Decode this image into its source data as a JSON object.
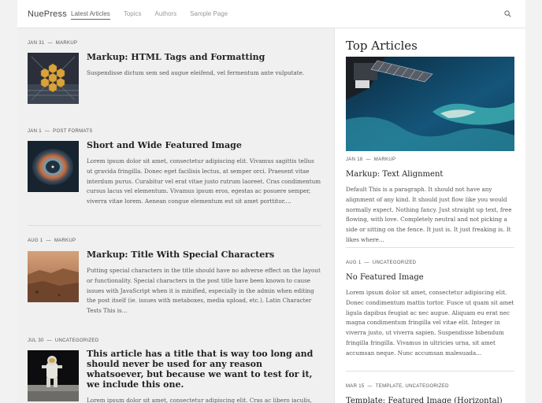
{
  "header": {
    "brand": "NuePress",
    "nav": [
      "Latest Articles",
      "Topics",
      "Authors",
      "Sample Page"
    ]
  },
  "icons": {
    "search": "search-icon"
  },
  "posts": [
    {
      "date": "JAN 31",
      "category": "MARKUP",
      "title": "Markup: HTML Tags and Formatting",
      "excerpt": "Suspendisse dictum sem sed augue eleifend, vel fermentum ante vulputate."
    },
    {
      "date": "JAN 1",
      "category": "POST FORMATS",
      "title": "Short and Wide Featured Image",
      "excerpt": "Lorem ipsum dolor sit amet, consectetur adipiscing elit. Vivamus sagittis tellus ut gravida fringilla. Donec eget facilisis lectus, at semper orci. Praesent vitae interdum purus. Curabitur vel erat vitae justo rutrum laoreet. Cras condimentum cursus lacus vel elementum. Vivamus ipsum eros, egestas ac posuere semper, viverra vitae lorem. Aenean congue elementum est sit amet porttitor...."
    },
    {
      "date": "AUG 1",
      "category": "MARKUP",
      "title": "Markup: Title With Special Characters",
      "excerpt": "Putting special characters in the title should have no adverse effect on the layout or functionality. Special characters in the post title have been known to cause issues with JavaScript when it is minified, especially in the admin when editing the post itself (ie. issues with metaboxes, media upload, etc.). Latin Character Tests This is..."
    },
    {
      "date": "JUL 30",
      "category": "UNCATEGORIZED",
      "title": "This article has a title that is way too long and should never be used for any reason whatsoever, but because we want to test for it, we include this one.",
      "excerpt": "Lorem ipsum dolor sit amet, consectetur adipiscing elit. Cras ac libero iaculis, accumsan enim at, faucibus mauris. Suspendisse id suscipit ex. Donec nisi..."
    }
  ],
  "sidebar": {
    "title": "Top Articles",
    "items": [
      {
        "date": "JAN 18",
        "category": "MARKUP",
        "title": "Markup: Text Alignment",
        "excerpt": "Default This is a paragraph. It should not have any alignment of any kind. It should just flow like you would normally expect. Nothing fancy. Just straight up text, free flowing, with love. Completely neutral and not picking a side or sitting on the fence. It just is. It just freaking is. It likes where..."
      },
      {
        "date": "AUG 1",
        "category": "UNCATEGORIZED",
        "title": "No Featured Image",
        "excerpt": "Lorem ipsum dolor sit amet, consectetur adipiscing elit. Donec condimentum mattis tortor. Fusce ut quam sit amet ligula dapibus feugiat ac nec augue. Aliquam eu erat nec magna condimentum fringilla vel vitae elit. Integer in viverra justo, ut viverra sapien. Suspendisse bibendum fringilla fringilla. Vivamus in ultricies urna, sit amet accumsan neque. Nunc accumsan malesuada..."
      },
      {
        "date": "MAR 15",
        "category": "TEMPLATE, UNCATEGORIZED",
        "title": "Template: Featured Image (Horizontal)",
        "excerpt": ""
      }
    ]
  }
}
